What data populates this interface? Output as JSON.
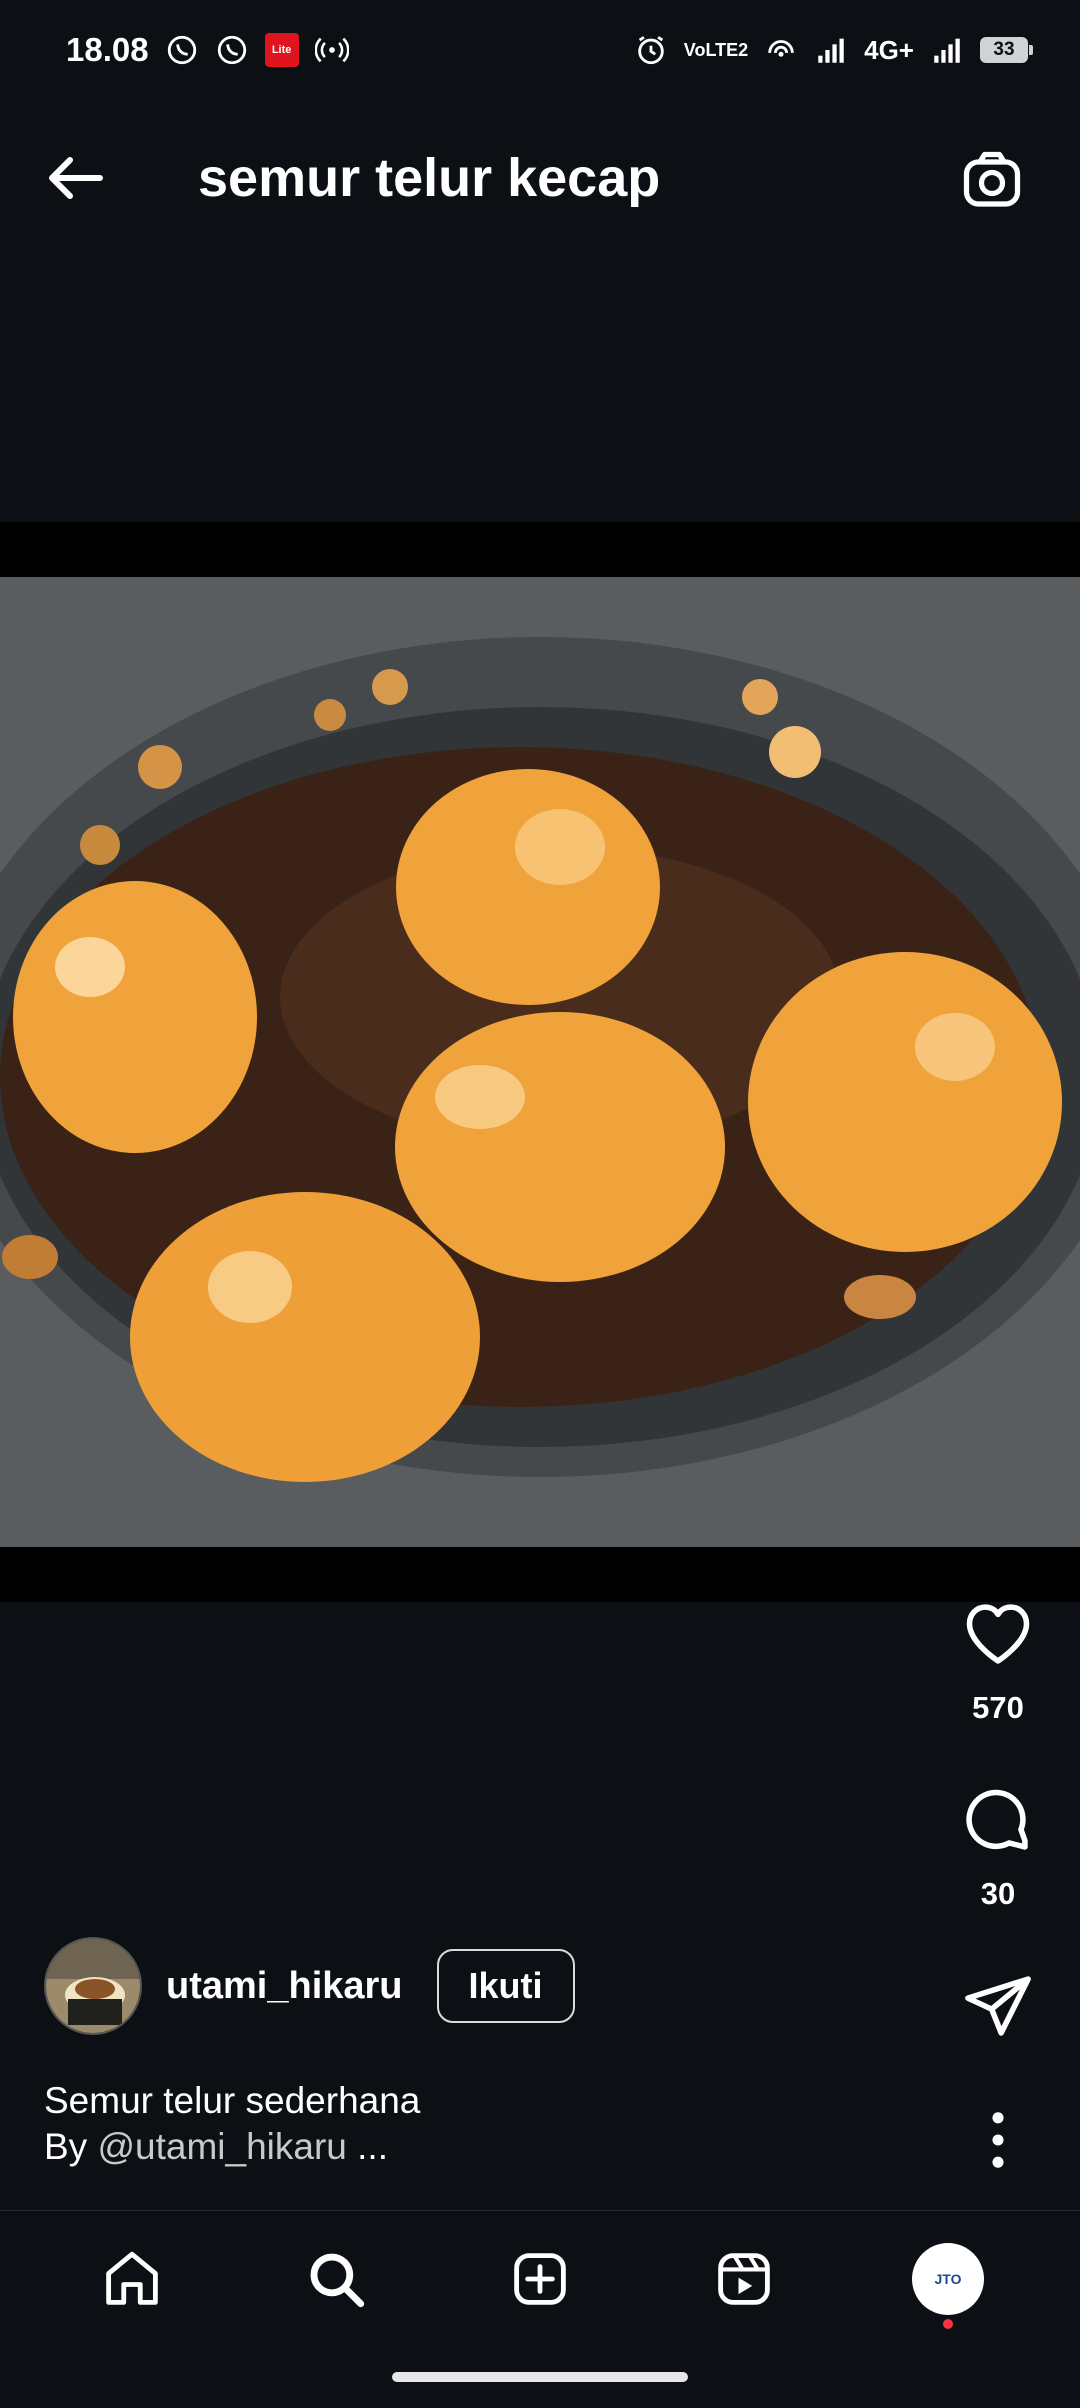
{
  "status_bar": {
    "time": "18.08",
    "lite_badge": "Lite",
    "volte": "VoLTE2",
    "network": "4G+",
    "battery": "33"
  },
  "header": {
    "title": "semur telur kecap"
  },
  "post": {
    "likes": "570",
    "comments": "30",
    "username": "utami_hikaru",
    "follow_label": "Ikuti",
    "caption_line1": "Semur telur sederhana",
    "caption_by": "By ",
    "caption_handle": "@utami_hikaru",
    "caption_more": " ..."
  },
  "bottom_nav": {
    "profile_text": "JTO"
  },
  "colors": {
    "background": "#0c1014",
    "egg": "#f0a23b",
    "sauce": "#3a2316",
    "pan": "#3a3d40",
    "notification": "#ff3040"
  }
}
